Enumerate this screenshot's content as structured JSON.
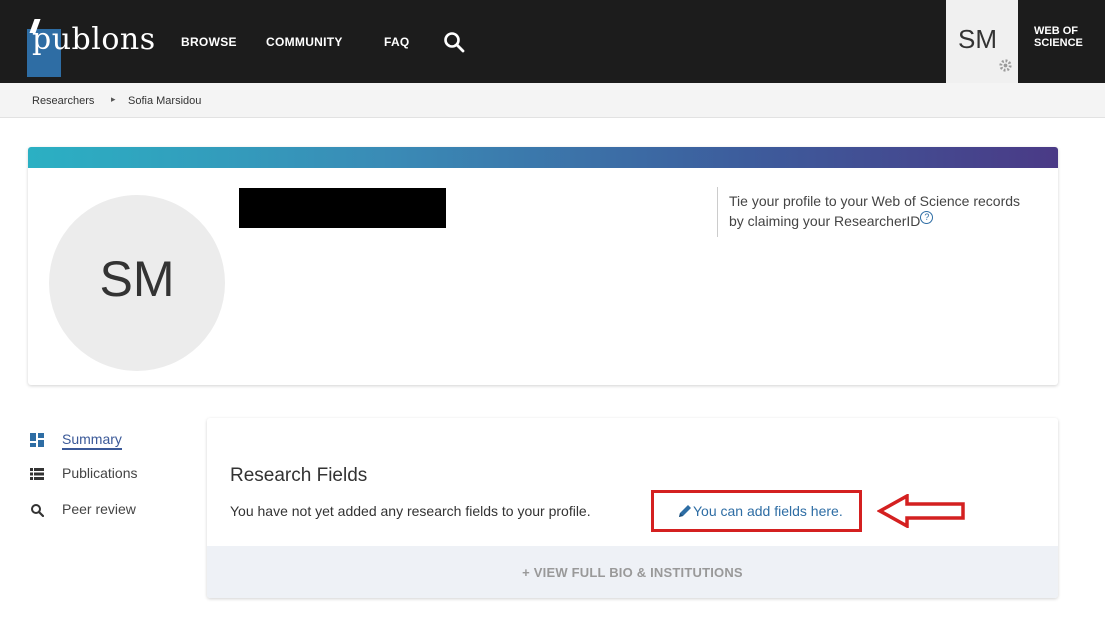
{
  "header": {
    "logo_text": "publons",
    "nav": [
      "BROWSE",
      "COMMUNITY",
      "FAQ"
    ],
    "user_initials": "SM",
    "web_of_science_line1": "WEB OF",
    "web_of_science_line2": "SCIENCE"
  },
  "breadcrumb": {
    "parent": "Researchers",
    "current": "Sofia Marsidou"
  },
  "profile": {
    "avatar_initials": "SM",
    "claim_text": "Tie your profile to your Web of Science records by claiming your ResearcherID",
    "help_icon_glyph": "?"
  },
  "sidebar": {
    "items": [
      {
        "label": "Summary",
        "icon": "dashboard-icon",
        "active": true
      },
      {
        "label": "Publications",
        "icon": "list-icon",
        "active": false
      },
      {
        "label": "Peer review",
        "icon": "search-icon",
        "active": false
      }
    ]
  },
  "research_fields": {
    "title": "Research Fields",
    "empty_message": "You have not yet added any research fields to your profile.",
    "add_link": "You can add fields here.",
    "view_full_bio": "+ VIEW FULL BIO & INSTITUTIONS"
  },
  "colors": {
    "topbar": "#1c1c1c",
    "brand_blue": "#2e6da4",
    "annotation_red": "#d42020",
    "active_nav": "#3b5998"
  }
}
